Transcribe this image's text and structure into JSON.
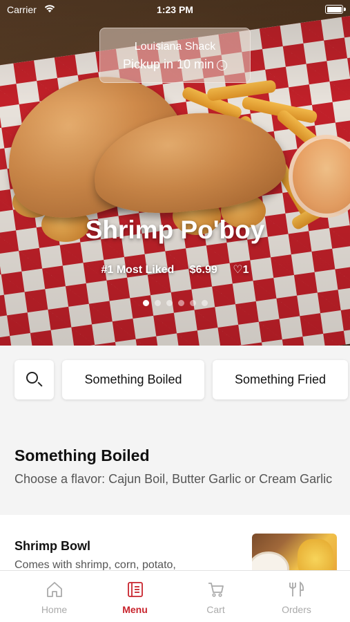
{
  "status_bar": {
    "carrier": "Carrier",
    "time": "1:23 PM"
  },
  "pickup": {
    "store": "Louisiana Shack",
    "eta": "Pickup in 10 min"
  },
  "hero": {
    "title": "Shrimp Po'boy",
    "rank": "#1 Most Liked",
    "price": "$6.99",
    "likes": "1",
    "slide_count": 6,
    "active_slide": 1
  },
  "categories": {
    "search_icon": "search-icon",
    "items": [
      "Something Boiled",
      "Something Fried"
    ]
  },
  "section": {
    "title": "Something Boiled",
    "description": "Choose a flavor: Cajun Boil, Butter Garlic or Cream Garlic"
  },
  "menu_items": [
    {
      "name": "Shrimp Bowl",
      "description": "Comes with shrimp, corn, potato,"
    }
  ],
  "tabs": [
    {
      "label": "Home",
      "icon": "home-icon"
    },
    {
      "label": "Menu",
      "icon": "menu-icon"
    },
    {
      "label": "Cart",
      "icon": "cart-icon"
    },
    {
      "label": "Orders",
      "icon": "orders-icon"
    }
  ],
  "active_tab": "Menu",
  "colors": {
    "accent": "#c8232c",
    "inactive": "#aaaaaa"
  }
}
